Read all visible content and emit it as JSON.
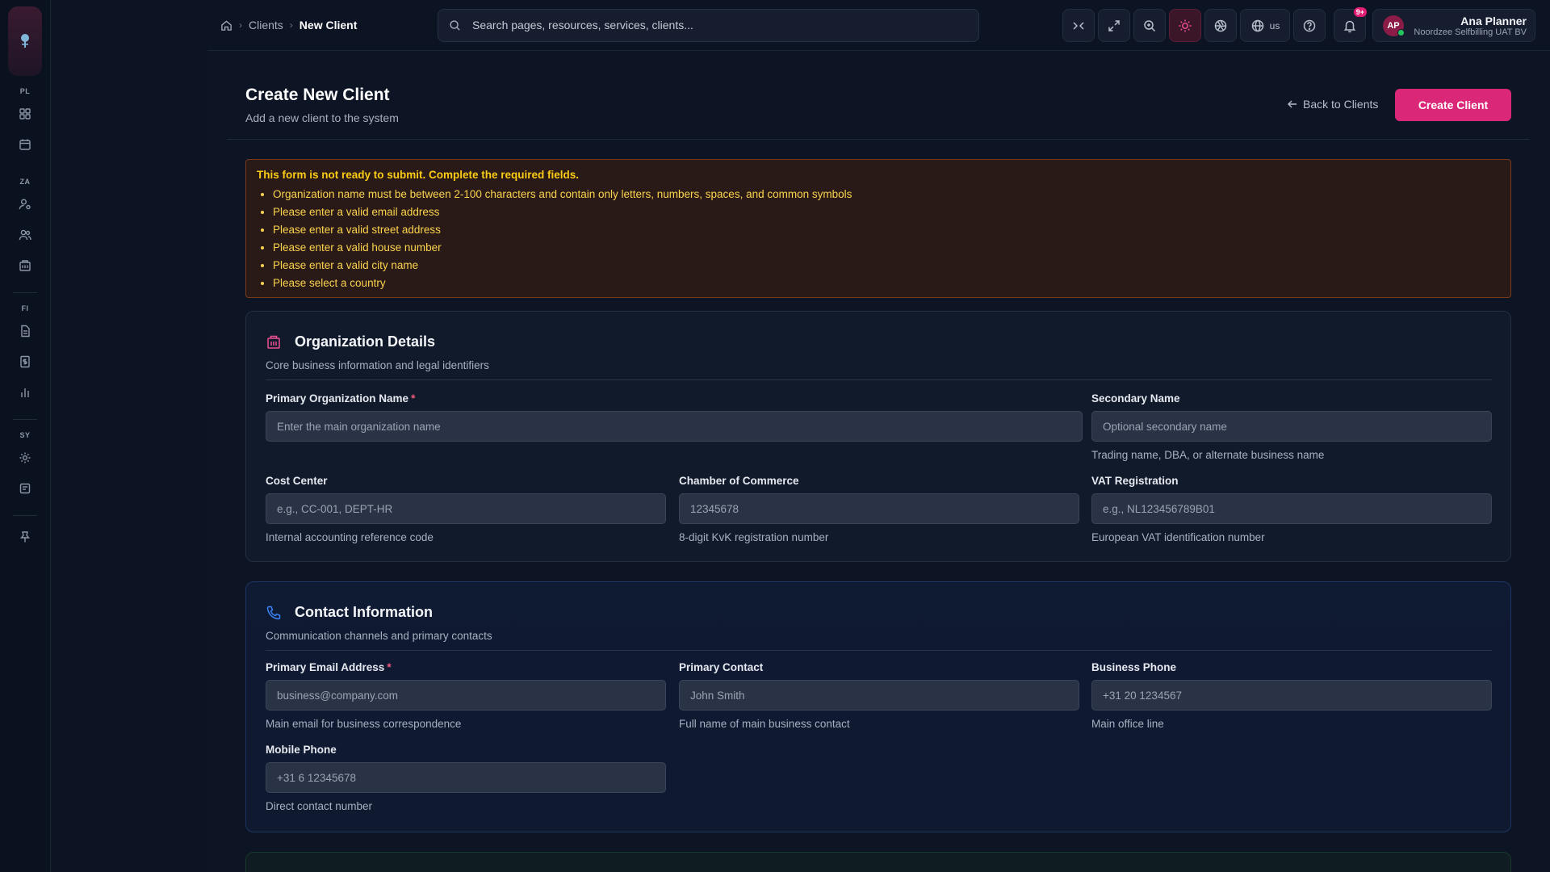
{
  "rail": {
    "groups": [
      {
        "label": "PL"
      },
      {
        "label": "ZA"
      },
      {
        "label": "FI"
      },
      {
        "label": "SY"
      }
    ]
  },
  "breadcrumb": {
    "items": [
      "Clients",
      "New Client"
    ]
  },
  "search": {
    "placeholder": "Search pages, resources, services, clients..."
  },
  "toolbar": {
    "language": "us",
    "notifications_badge": "9+"
  },
  "user": {
    "initials": "AP",
    "name": "Ana Planner",
    "org": "Noordzee Selfbilling UAT BV"
  },
  "page": {
    "title": "Create New Client",
    "subtitle": "Add a new client to the system",
    "back_label": "Back to Clients",
    "create_label": "Create Client"
  },
  "errors": {
    "title": "This form is not ready to submit. Complete the required fields.",
    "items": [
      "Organization name must be between 2-100 characters and contain only letters, numbers, spaces, and common symbols",
      "Please enter a valid email address",
      "Please enter a valid street address",
      "Please enter a valid house number",
      "Please enter a valid city name",
      "Please select a country"
    ]
  },
  "org": {
    "title": "Organization Details",
    "subtitle": "Core business information and legal identifiers",
    "primary_name": {
      "label": "Primary Organization Name",
      "required": "*",
      "placeholder": "Enter the main organization name"
    },
    "secondary_name": {
      "label": "Secondary Name",
      "placeholder": "Optional secondary name",
      "help": "Trading name, DBA, or alternate business name"
    },
    "cost_center": {
      "label": "Cost Center",
      "placeholder": "e.g., CC-001, DEPT-HR",
      "help": "Internal accounting reference code"
    },
    "chamber": {
      "label": "Chamber of Commerce",
      "placeholder": "12345678",
      "help": "8-digit KvK registration number"
    },
    "vat": {
      "label": "VAT Registration",
      "placeholder": "e.g., NL123456789B01",
      "help": "European VAT identification number"
    }
  },
  "contact": {
    "title": "Contact Information",
    "subtitle": "Communication channels and primary contacts",
    "email": {
      "label": "Primary Email Address",
      "required": "*",
      "placeholder": "business@company.com",
      "help": "Main email for business correspondence"
    },
    "primary_contact": {
      "label": "Primary Contact",
      "placeholder": "John Smith",
      "help": "Full name of main business contact"
    },
    "business_phone": {
      "label": "Business Phone",
      "placeholder": "+31 20 1234567",
      "help": "Main office line"
    },
    "mobile": {
      "label": "Mobile Phone",
      "placeholder": "+31 6 12345678",
      "help": "Direct contact number"
    }
  },
  "colors": {
    "accent": "#db2777",
    "warning": "#facc15",
    "info_icon": "#3b82f6"
  }
}
